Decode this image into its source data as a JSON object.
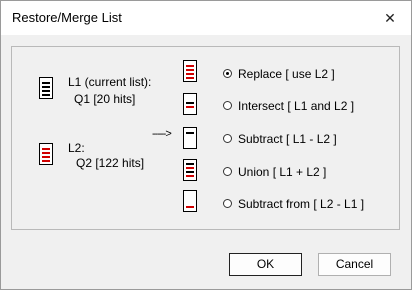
{
  "window": {
    "title": "Restore/Merge List",
    "close_glyph": "✕"
  },
  "l1": {
    "line1": "L1 (current list):",
    "line2": "Q1 [20 hits]"
  },
  "l2": {
    "line1": "L2:",
    "line2": "Q2 [122 hits]"
  },
  "arrow": "----->",
  "options": [
    {
      "label": "Replace  [ use L2 ]",
      "selected": true,
      "icon": "replace-list-icon"
    },
    {
      "label": "Intersect  [ L1 and L2 ]",
      "selected": false,
      "icon": "intersect-list-icon"
    },
    {
      "label": "Subtract  [ L1 - L2 ]",
      "selected": false,
      "icon": "subtract-list-icon"
    },
    {
      "label": "Union  [ L1 + L2 ]",
      "selected": false,
      "icon": "union-list-icon"
    },
    {
      "label": "Subtract from  [ L2 - L1 ]",
      "selected": false,
      "icon": "subtract-from-list-icon"
    }
  ],
  "buttons": {
    "ok": "OK",
    "cancel": "Cancel"
  },
  "colors": {
    "accent_red": "#d00000",
    "bar_black": "#000000"
  }
}
